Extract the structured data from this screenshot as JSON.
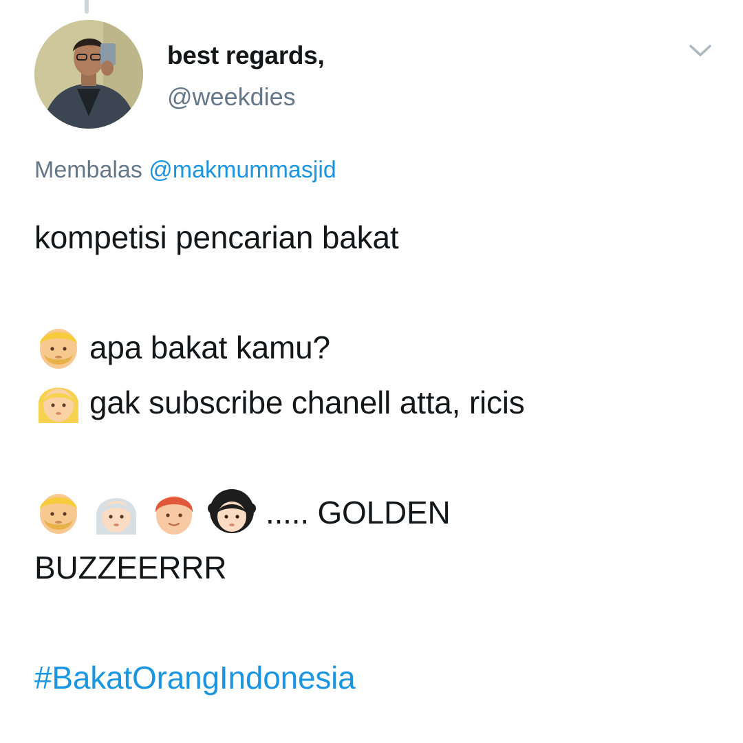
{
  "tweet": {
    "author": {
      "display_name": "best regards,",
      "handle": "@weekdies",
      "avatar_icon": "profile-photo"
    },
    "menu_icon": "chevron-down-icon",
    "reply_prefix": "Membalas",
    "reply_mention": "@makmummasjid",
    "lines": {
      "line1": "kompetisi pencarian bakat",
      "line2": "apa bakat kamu?",
      "line3": "gak subscribe chanell atta, ricis",
      "line4": "..... GOLDEN",
      "line5": "BUZZEERRR"
    },
    "emojis": {
      "line2": "man-blond-emoji",
      "line3": "woman-blond-emoji",
      "line4": [
        "man-blond-emoji",
        "woman-white-hair-emoji",
        "man-red-hair-emoji",
        "woman-curly-hair-emoji"
      ]
    },
    "hashtag": "#BakatOrangIndonesia"
  },
  "colors": {
    "text": "#14171a",
    "secondary": "#657786",
    "link": "#1b95e0",
    "background": "#ffffff"
  }
}
